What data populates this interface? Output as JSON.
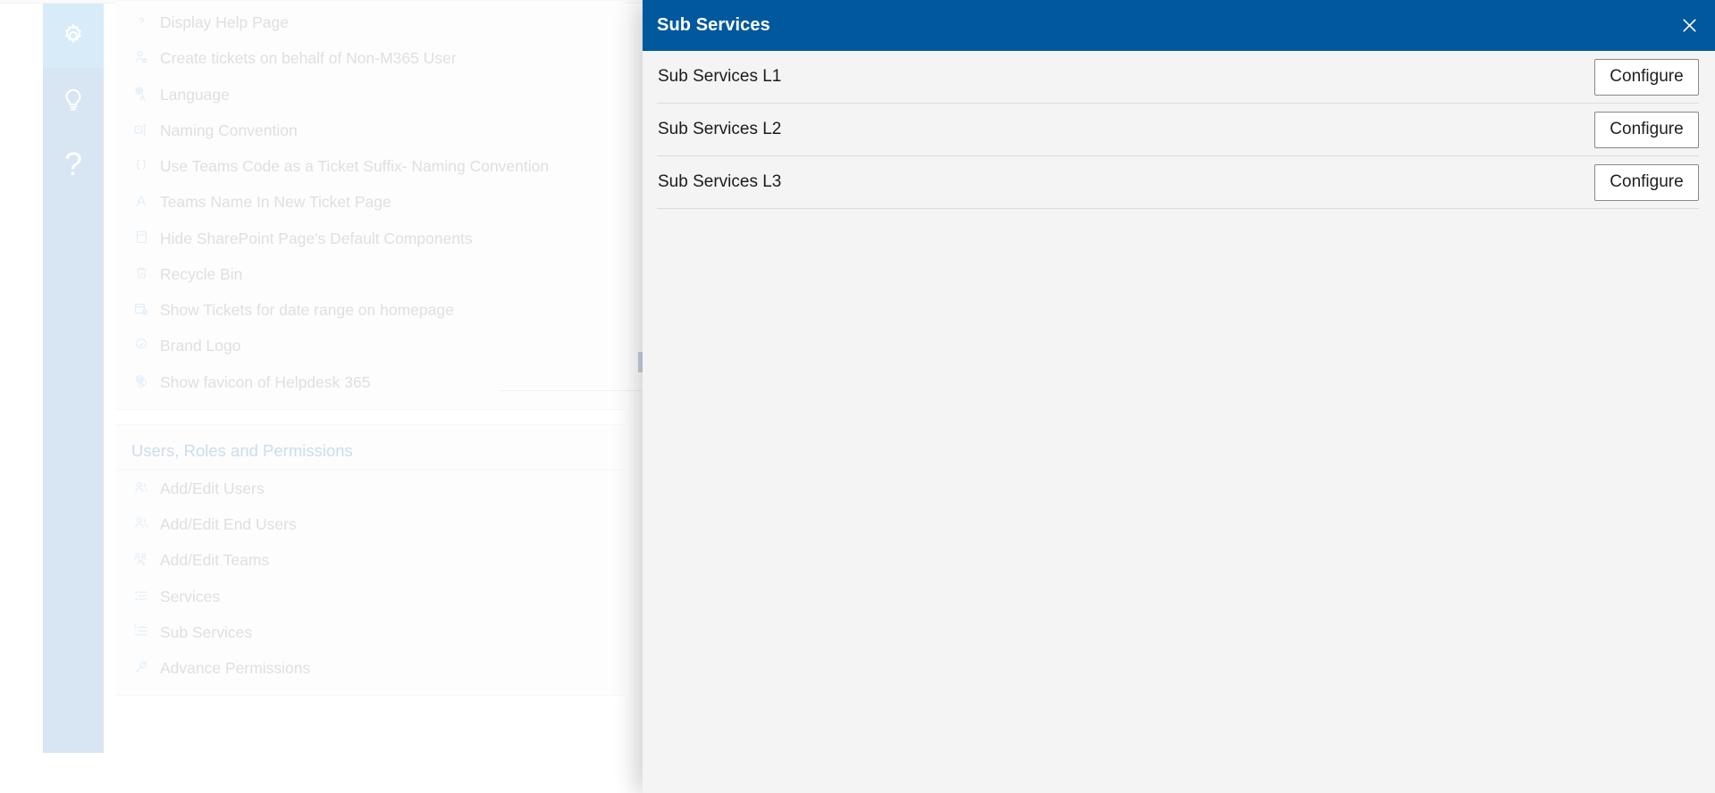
{
  "icon_rail": {
    "items": [
      {
        "name": "settings-gear",
        "icon": "gear-icon",
        "active": true
      },
      {
        "name": "ideas-lightbulb",
        "icon": "lightbulb-icon",
        "active": false
      },
      {
        "name": "help-question",
        "icon": "question-mark-icon",
        "active": false,
        "glyph": "?"
      }
    ]
  },
  "settings_sidebar": {
    "groups": [
      {
        "title": "",
        "items": [
          {
            "label": "Display Help Page",
            "icon": "question-mark-icon"
          },
          {
            "label": "Create tickets on behalf of Non-M365 User",
            "icon": "user-block-icon"
          },
          {
            "label": "Language",
            "icon": "translate-icon"
          },
          {
            "label": "Naming Convention",
            "icon": "rename-icon"
          },
          {
            "label": "Use Teams Code as a Ticket Suffix- Naming Convention",
            "icon": "braces-icon"
          },
          {
            "label": "Teams Name In New Ticket Page",
            "icon": "font-a-icon"
          },
          {
            "label": "Hide SharePoint Page's Default Components",
            "icon": "page-layout-icon"
          },
          {
            "label": "Recycle Bin",
            "icon": "recycle-bin-icon"
          },
          {
            "label": "Show Tickets for date range on homepage",
            "icon": "calendar-clock-icon"
          },
          {
            "label": "Brand Logo",
            "icon": "badge-check-icon"
          },
          {
            "label": "Show favicon of Helpdesk 365",
            "icon": "sharepoint-icon"
          }
        ]
      },
      {
        "title": "Users, Roles and Permissions",
        "items": [
          {
            "label": "Add/Edit Users",
            "icon": "people-icon"
          },
          {
            "label": "Add/Edit End Users",
            "icon": "people-icon"
          },
          {
            "label": "Add/Edit Teams",
            "icon": "team-icon"
          },
          {
            "label": "Services",
            "icon": "list-icon"
          },
          {
            "label": "Sub Services",
            "icon": "sub-list-icon"
          },
          {
            "label": "Advance Permissions",
            "icon": "key-icon"
          }
        ]
      }
    ]
  },
  "flyout": {
    "title": "Sub Services",
    "close_label": "Close",
    "rows": [
      {
        "label": "Sub Services L1",
        "action_label": "Configure"
      },
      {
        "label": "Sub Services L2",
        "action_label": "Configure"
      },
      {
        "label": "Sub Services L3",
        "action_label": "Configure"
      }
    ]
  },
  "colors": {
    "header_blue": "#00589d",
    "rail_blue": "#a6c8e2",
    "rail_active_blue": "#a8d3f0",
    "group_title_blue": "#8cb4d8",
    "panel_bg": "#f4f4f4",
    "row_divider": "#dcdcdc",
    "button_border": "#8a8886"
  }
}
